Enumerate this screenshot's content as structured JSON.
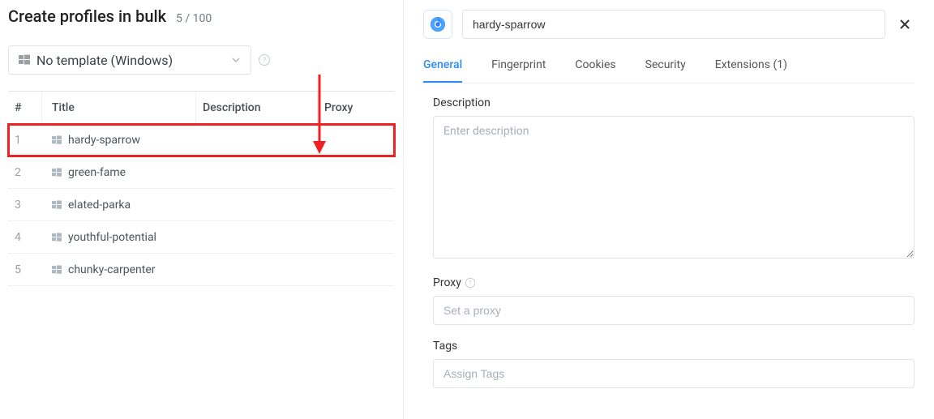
{
  "header": {
    "title": "Create profiles in bulk",
    "count": "5 / 100"
  },
  "template": {
    "label": "No template (Windows)"
  },
  "columns": {
    "index": "#",
    "title": "Title",
    "description": "Description",
    "proxy": "Proxy"
  },
  "rows": [
    {
      "n": "1",
      "title": "hardy-sparrow"
    },
    {
      "n": "2",
      "title": "green-fame"
    },
    {
      "n": "3",
      "title": "elated-parka"
    },
    {
      "n": "4",
      "title": "youthful-potential"
    },
    {
      "n": "5",
      "title": "chunky-carpenter"
    }
  ],
  "detail": {
    "name": "hardy-sparrow"
  },
  "tabs": {
    "general": "General",
    "fingerprint": "Fingerprint",
    "cookies": "Cookies",
    "security": "Security",
    "extensions": "Extensions (1)"
  },
  "form": {
    "description_label": "Description",
    "description_placeholder": "Enter description",
    "proxy_label": "Proxy",
    "proxy_placeholder": "Set a proxy",
    "tags_label": "Tags",
    "tags_placeholder": "Assign Tags"
  }
}
